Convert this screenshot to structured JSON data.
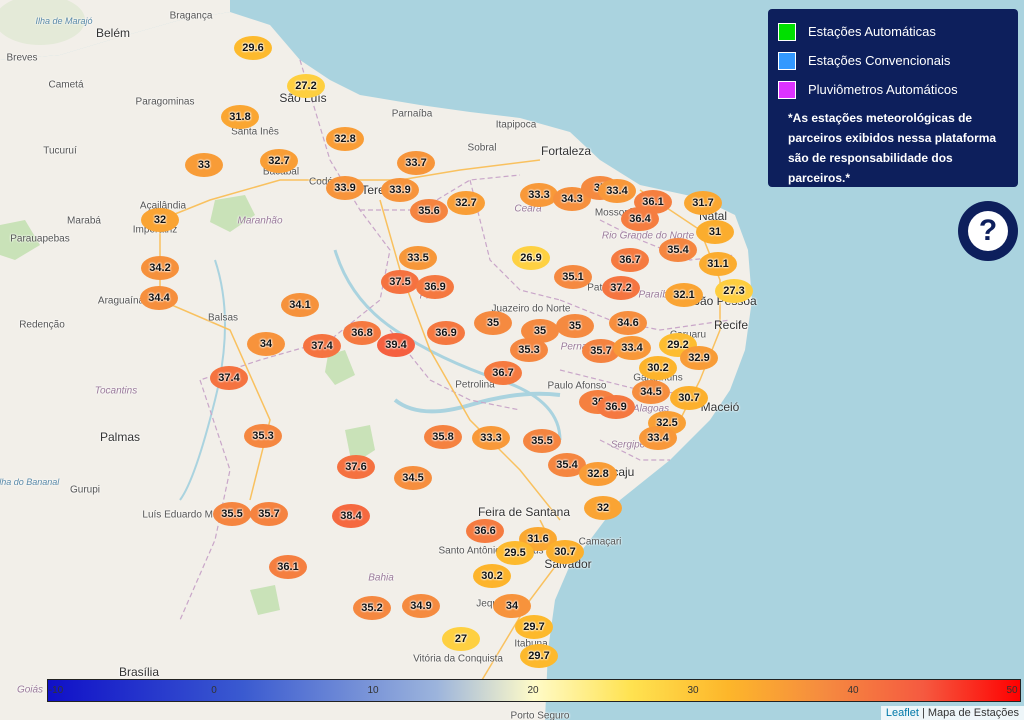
{
  "legend": {
    "items": [
      {
        "label": "Estações Automáticas",
        "color": "#00e000"
      },
      {
        "label": "Estações Convencionais",
        "color": "#3399ff"
      },
      {
        "label": "Pluviômetros Automáticos",
        "color": "#dd33ff"
      }
    ],
    "note": "*As estações meteorológicas de parceiros exibidos nessa plataforma são de responsabilidade dos parceiros.*"
  },
  "help_button": {
    "label": "?"
  },
  "places": [
    {
      "name": "Ilha de Marajó",
      "cls": "water"
    },
    {
      "name": "Belém",
      "cls": "big"
    },
    {
      "name": "Bragança",
      "cls": ""
    },
    {
      "name": "Breves",
      "cls": ""
    },
    {
      "name": "Cametá",
      "cls": ""
    },
    {
      "name": "Paragominas",
      "cls": ""
    },
    {
      "name": "São Luís",
      "cls": "big"
    },
    {
      "name": "Santa Inês",
      "cls": ""
    },
    {
      "name": "Parnaíba",
      "cls": ""
    },
    {
      "name": "Itapipoca",
      "cls": ""
    },
    {
      "name": "Fortaleza",
      "cls": "big"
    },
    {
      "name": "Sobral",
      "cls": ""
    },
    {
      "name": "Tucuruí",
      "cls": ""
    },
    {
      "name": "Bacabal",
      "cls": ""
    },
    {
      "name": "Codó",
      "cls": ""
    },
    {
      "name": "Teresina",
      "cls": "big"
    },
    {
      "name": "Ceará",
      "cls": "state"
    },
    {
      "name": "Mossoró",
      "cls": ""
    },
    {
      "name": "Natal",
      "cls": "big"
    },
    {
      "name": "Marabá",
      "cls": ""
    },
    {
      "name": "Açailândia",
      "cls": ""
    },
    {
      "name": "Imperatriz",
      "cls": ""
    },
    {
      "name": "Maranhão",
      "cls": "state"
    },
    {
      "name": "Parauapebas",
      "cls": ""
    },
    {
      "name": "Rio Grande do Norte",
      "cls": "state"
    },
    {
      "name": "Piauí",
      "cls": "state"
    },
    {
      "name": "Paraíba",
      "cls": "state"
    },
    {
      "name": "João Pessoa",
      "cls": "big"
    },
    {
      "name": "Patos",
      "cls": ""
    },
    {
      "name": "Araguaína",
      "cls": ""
    },
    {
      "name": "Juazeiro do Norte",
      "cls": ""
    },
    {
      "name": "Recife",
      "cls": "big"
    },
    {
      "name": "Balsas",
      "cls": ""
    },
    {
      "name": "Redenção",
      "cls": ""
    },
    {
      "name": "Pernambuco",
      "cls": "state"
    },
    {
      "name": "Caruaru",
      "cls": ""
    },
    {
      "name": "Garanhuns",
      "cls": ""
    },
    {
      "name": "Petrolina",
      "cls": ""
    },
    {
      "name": "Paulo Afonso",
      "cls": ""
    },
    {
      "name": "Tocantins",
      "cls": "state"
    },
    {
      "name": "Alagoas",
      "cls": "state"
    },
    {
      "name": "Maceió",
      "cls": "big"
    },
    {
      "name": "Palmas",
      "cls": "big"
    },
    {
      "name": "Sergipe",
      "cls": "state"
    },
    {
      "name": "Aracaju",
      "cls": "big"
    },
    {
      "name": "Ilha do Bananal",
      "cls": "water"
    },
    {
      "name": "Gurupi",
      "cls": ""
    },
    {
      "name": "Feira de Santana",
      "cls": "big"
    },
    {
      "name": "Luís Eduardo Magalhães",
      "cls": ""
    },
    {
      "name": "Camaçari",
      "cls": ""
    },
    {
      "name": "Santo Antônio de Jesus",
      "cls": ""
    },
    {
      "name": "Salvador",
      "cls": "big"
    },
    {
      "name": "Bahia",
      "cls": "state"
    },
    {
      "name": "Jequié",
      "cls": ""
    },
    {
      "name": "Itabuna",
      "cls": ""
    },
    {
      "name": "Vitória da Conquista",
      "cls": ""
    },
    {
      "name": "Brasília",
      "cls": "big"
    },
    {
      "name": "Goiás",
      "cls": "state"
    },
    {
      "name": "Porto Seguro",
      "cls": ""
    }
  ],
  "stations": [
    {
      "v": 29.6
    },
    {
      "v": 27.2
    },
    {
      "v": 31.8
    },
    {
      "v": 32.8
    },
    {
      "v": 33
    },
    {
      "v": 32.7
    },
    {
      "v": 33.7
    },
    {
      "v": 33.9
    },
    {
      "v": 33.9
    },
    {
      "v": 35.6
    },
    {
      "v": 32.7
    },
    {
      "v": 33.3
    },
    {
      "v": 34.3
    },
    {
      "v": 35
    },
    {
      "v": 33.4
    },
    {
      "v": 36.1
    },
    {
      "v": 31.7
    },
    {
      "v": 36.4
    },
    {
      "v": 31
    },
    {
      "v": 32
    },
    {
      "v": 35.4
    },
    {
      "v": 26.9
    },
    {
      "v": 33.5
    },
    {
      "v": 31.1
    },
    {
      "v": 34.2
    },
    {
      "v": 36.7
    },
    {
      "v": 37.5
    },
    {
      "v": 36.9
    },
    {
      "v": 35.1
    },
    {
      "v": 34.4
    },
    {
      "v": 37.2
    },
    {
      "v": 32.1
    },
    {
      "v": 27.3
    },
    {
      "v": 34.1
    },
    {
      "v": 35
    },
    {
      "v": 35
    },
    {
      "v": 35
    },
    {
      "v": 34.6
    },
    {
      "v": 34
    },
    {
      "v": 37.4
    },
    {
      "v": 36.8
    },
    {
      "v": 39.4
    },
    {
      "v": 36.9
    },
    {
      "v": 35.3
    },
    {
      "v": 35.7
    },
    {
      "v": 33.4
    },
    {
      "v": 29.2
    },
    {
      "v": 32.9
    },
    {
      "v": 37.4
    },
    {
      "v": 36.7
    },
    {
      "v": 30.2
    },
    {
      "v": 34.5
    },
    {
      "v": 36
    },
    {
      "v": 36.9
    },
    {
      "v": 30.7
    },
    {
      "v": 32.5
    },
    {
      "v": 35.3
    },
    {
      "v": 35.8
    },
    {
      "v": 33.3
    },
    {
      "v": 35.5
    },
    {
      "v": 33.4
    },
    {
      "v": 37.6
    },
    {
      "v": 34.5
    },
    {
      "v": 35.4
    },
    {
      "v": 32.8
    },
    {
      "v": 35.5
    },
    {
      "v": 35.7
    },
    {
      "v": 38.4
    },
    {
      "v": 32
    },
    {
      "v": 36.6
    },
    {
      "v": 31.6
    },
    {
      "v": 29.5
    },
    {
      "v": 30.7
    },
    {
      "v": 36.1
    },
    {
      "v": 30.2
    },
    {
      "v": 34
    },
    {
      "v": 35.2
    },
    {
      "v": 34.9
    },
    {
      "v": 27
    },
    {
      "v": 29.7
    },
    {
      "v": 29.7
    }
  ],
  "scale": {
    "ticks": [
      "-10",
      "0",
      "10",
      "20",
      "30",
      "40",
      "50"
    ]
  },
  "attribution": {
    "link": "Leaflet",
    "text": "| Mapa de Estações"
  }
}
